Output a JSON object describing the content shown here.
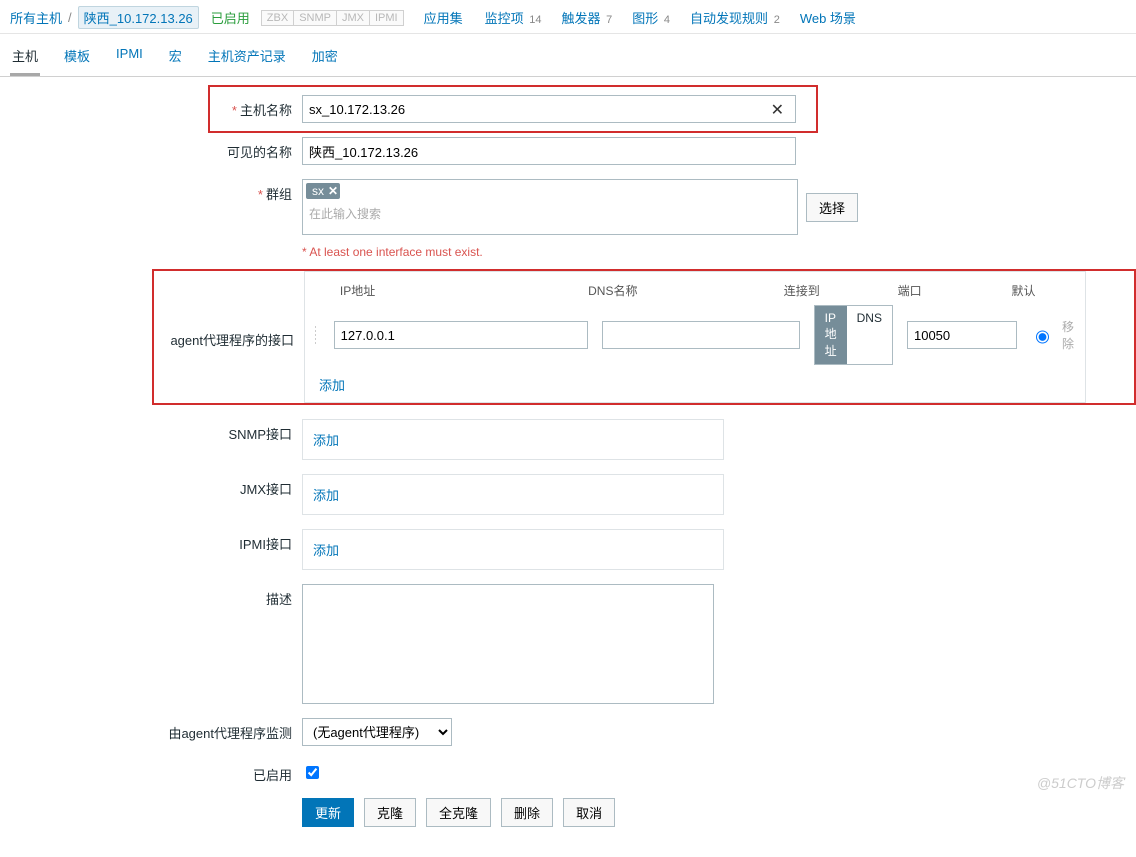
{
  "breadcrumb": {
    "all_hosts": "所有主机",
    "current_host": "陕西_10.172.13.26",
    "status": "已启用",
    "protocols": [
      "ZBX",
      "SNMP",
      "JMX",
      "IPMI"
    ],
    "links": [
      {
        "label": "应用集",
        "count": ""
      },
      {
        "label": "监控项",
        "count": "14"
      },
      {
        "label": "触发器",
        "count": "7"
      },
      {
        "label": "图形",
        "count": "4"
      },
      {
        "label": "自动发现规则",
        "count": "2"
      },
      {
        "label": "Web 场景",
        "count": ""
      }
    ]
  },
  "tabs": [
    "主机",
    "模板",
    "IPMI",
    "宏",
    "主机资产记录",
    "加密"
  ],
  "active_tab": 0,
  "labels": {
    "host_name": "主机名称",
    "visible_name": "可见的名称",
    "groups": "群组",
    "groups_placeholder": "在此输入搜索",
    "select_btn": "选择",
    "interface_warn": "* At least one interface must exist.",
    "agent_if": "agent代理程序的接口",
    "snmp_if": "SNMP接口",
    "jmx_if": "JMX接口",
    "ipmi_if": "IPMI接口",
    "description": "描述",
    "monitored_by": "由agent代理程序监测",
    "enabled": "已启用",
    "add": "添加",
    "remove": "移除"
  },
  "interface_headers": {
    "ip": "IP地址",
    "dns": "DNS名称",
    "connect": "连接到",
    "port": "端口",
    "default": "默认"
  },
  "form": {
    "host_name": "sx_10.172.13.26",
    "visible_name": "陕西_10.172.13.26",
    "group_tag": "sx",
    "agent": {
      "ip": "127.0.0.1",
      "dns": "",
      "connect_ip": "IP地址",
      "connect_dns": "DNS",
      "port": "10050"
    },
    "description": "",
    "monitored_by": "(无agent代理程序)",
    "enabled": true
  },
  "buttons": {
    "update": "更新",
    "clone": "克隆",
    "full_clone": "全克隆",
    "delete": "删除",
    "cancel": "取消"
  },
  "watermark": "@51CTO博客"
}
